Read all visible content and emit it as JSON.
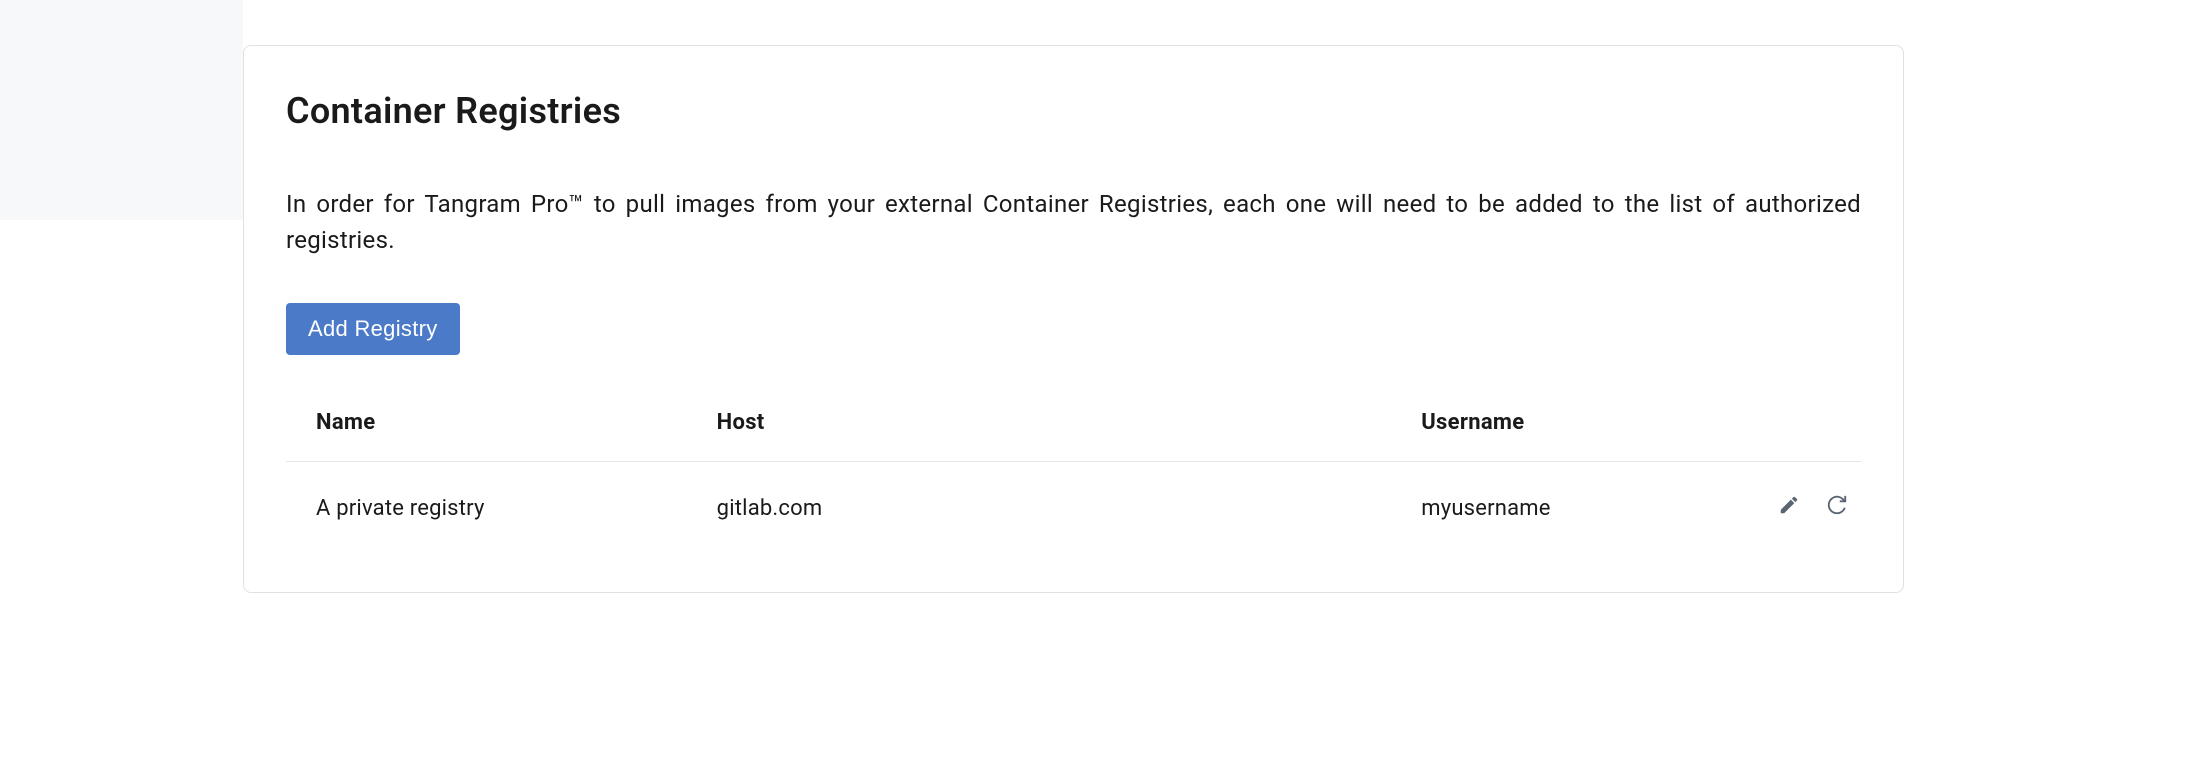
{
  "header": {
    "title": "Container Registries",
    "description": "In order for Tangram Pro™ to pull images from your external Container Registries, each one will need to be added to the list of authorized registries.",
    "add_button": "Add Registry"
  },
  "table": {
    "columns": {
      "name": "Name",
      "host": "Host",
      "username": "Username"
    },
    "rows": [
      {
        "name": "A private registry",
        "host": "gitlab.com",
        "username": "myusername"
      }
    ]
  }
}
